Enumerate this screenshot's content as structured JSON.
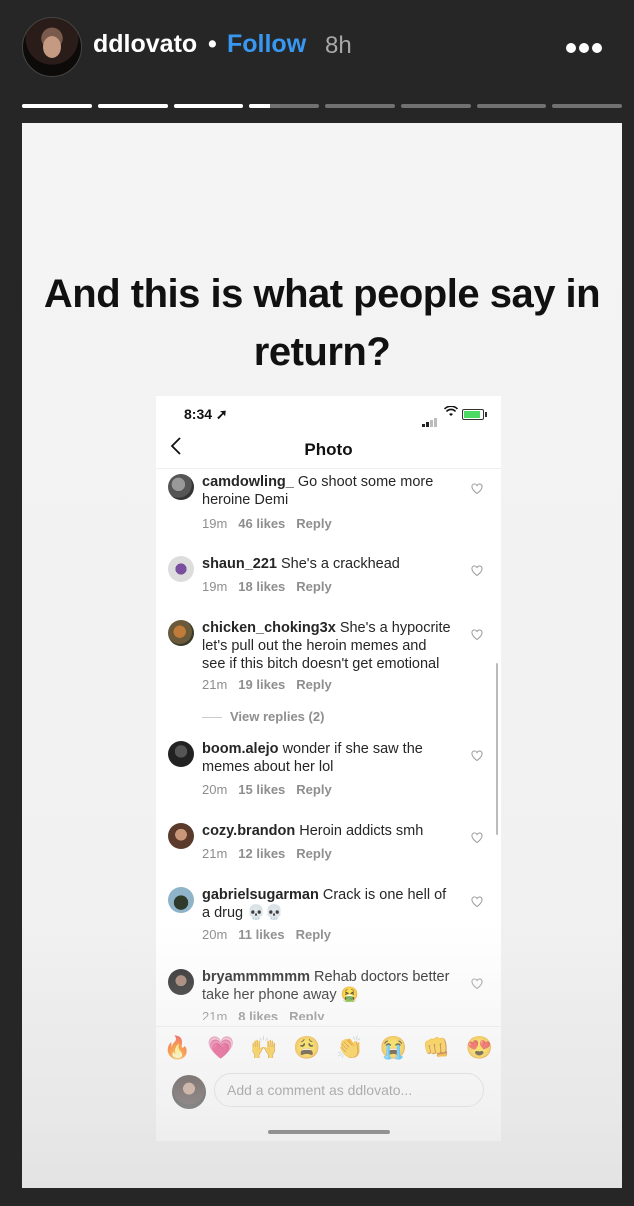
{
  "header": {
    "username": "ddlovato",
    "separator": "•",
    "follow_label": "Follow",
    "time_ago": "8h",
    "more_icon": "more-horizontal-icon"
  },
  "progress": {
    "segments": 8,
    "active_index": 3,
    "active_fraction": 0.3
  },
  "story": {
    "headline": "And this is what people say in return?"
  },
  "phone": {
    "status_time": "8:34",
    "battery_color": "#4cd964",
    "nav_title": "Photo",
    "comments": [
      {
        "user": "camdowling_",
        "text": "Go shoot some more heroine Demi",
        "time": "19m",
        "likes": "46 likes",
        "reply": "Reply"
      },
      {
        "user": "shaun_221",
        "text": "She's a crackhead",
        "time": "19m",
        "likes": "18 likes",
        "reply": "Reply"
      },
      {
        "user": "chicken_choking3x",
        "text": "She's a hypocrite let's pull out the heroin memes and see if this bitch doesn't get emotional",
        "time": "21m",
        "likes": "19 likes",
        "reply": "Reply"
      },
      {
        "user": "boom.alejo",
        "text": "wonder if she saw the memes about her lol",
        "time": "20m",
        "likes": "15 likes",
        "reply": "Reply"
      },
      {
        "user": "cozy.brandon",
        "text": "Heroin addicts smh",
        "time": "21m",
        "likes": "12 likes",
        "reply": "Reply"
      },
      {
        "user": "gabrielsugarman",
        "text": "Crack is one hell of a drug 💀💀",
        "time": "20m",
        "likes": "11 likes",
        "reply": "Reply"
      },
      {
        "user": "bryammmmmm",
        "text": "Rehab doctors better take her phone away 🤮",
        "time": "21m",
        "likes": "8 likes",
        "reply": "Reply"
      }
    ],
    "view_replies": "View replies (2)",
    "emojis": [
      "🔥",
      "💗",
      "🙌",
      "😩",
      "👏",
      "😭",
      "👊",
      "😍"
    ],
    "comment_placeholder": "Add a comment as ddlovato..."
  },
  "colors": {
    "background": "#262626",
    "follow": "#3897f0",
    "meta_gray": "#8e8e8e"
  }
}
